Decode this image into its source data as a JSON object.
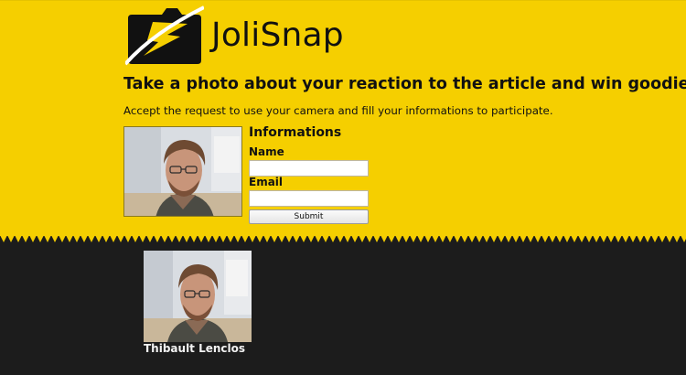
{
  "brand": {
    "name": "JoliSnap"
  },
  "intro": {
    "headline": "Take a photo about your reaction to the article and win goodies !",
    "instructions": "Accept the request to use your camera and fill your informations to participate."
  },
  "form": {
    "title": "Informations",
    "name_label": "Name",
    "name_value": "",
    "email_label": "Email",
    "email_value": "",
    "submit_label": "Submit"
  },
  "gallery": [
    {
      "author": "Thibault Lenclos"
    }
  ],
  "colors": {
    "accent": "#f5cf00",
    "dark": "#1c1c1c"
  }
}
